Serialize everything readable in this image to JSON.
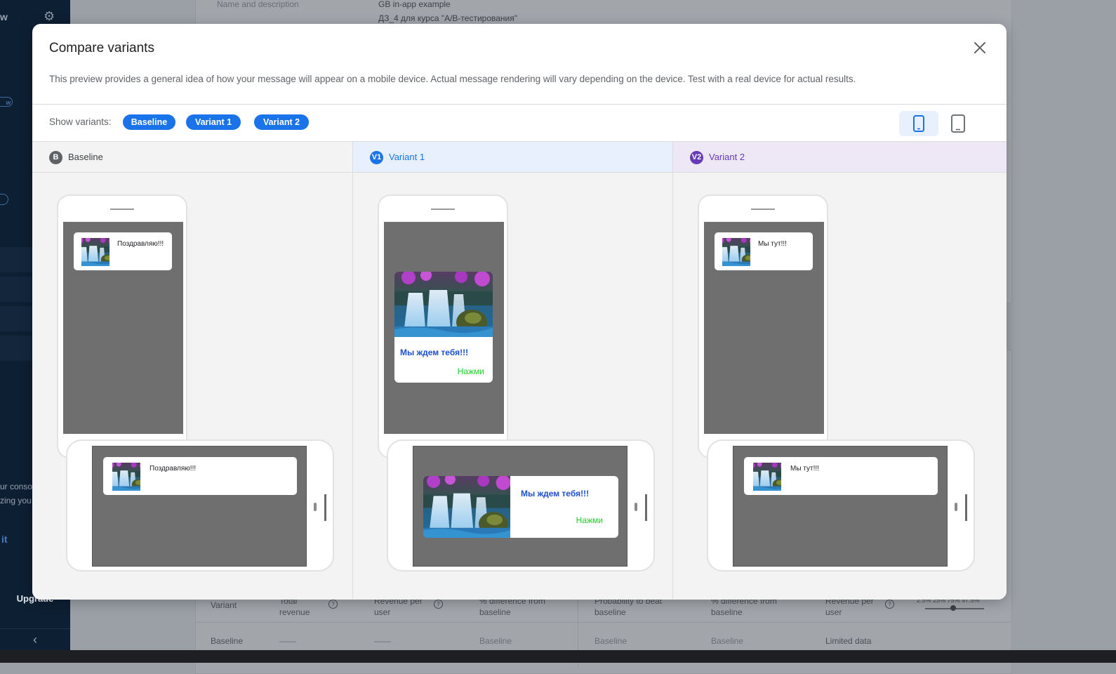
{
  "background": {
    "sidebar": {
      "fragment_top": "w",
      "text_fragment1": "ur conso",
      "text_fragment2": "zing you",
      "link_fragment": "it",
      "upgrade_label": "Upgrade",
      "collapse_glyph": "‹"
    },
    "card": {
      "field_label": "Name and description",
      "name_value": "GB in-app example",
      "description_value": "ДЗ_4 для курса \"A/B-тестирования\""
    },
    "table": {
      "headers": {
        "variant": "Variant",
        "total_revenue": "Total revenue",
        "revenue_per_user": "Revenue per user",
        "pct_diff_1": "% difference from baseline",
        "prob_beat": "Probability to beat baseline",
        "pct_diff_2": "% difference from baseline",
        "revenue_per_user_2": "Revenue per user",
        "interval_labels": "2.5%  25%  75% 97.5%"
      },
      "row": {
        "variant": "Baseline",
        "total_revenue": "——",
        "revenue_per_user": "——",
        "pct_diff_1": "Baseline",
        "prob_beat": "Baseline",
        "pct_diff_2": "Baseline",
        "revenue_per_user_2": "Limited data"
      }
    }
  },
  "modal": {
    "title": "Compare variants",
    "description": "This preview provides a general idea of how your message will appear on a mobile device. Actual message rendering will vary depending on the device. Test with a real device for actual results.",
    "show_variants_label": "Show variants:",
    "chips": [
      "Baseline",
      "Variant 1",
      "Variant 2"
    ],
    "device_toggle": {
      "selected": "phone",
      "options": [
        "phone-icon",
        "tablet-icon"
      ]
    },
    "columns": [
      {
        "badge": "B",
        "title": "Baseline",
        "badge_color": "#5f6368",
        "title_color": "#3c4043",
        "header_bg": "#f3f3f3",
        "format": "banner",
        "message_text": "Поздравляю!!!"
      },
      {
        "badge": "V1",
        "title": "Variant 1",
        "badge_color": "#1a73e8",
        "title_color": "#1a73e8",
        "header_bg": "#e8f0fe",
        "format": "card",
        "message_title": "Мы ждем тебя!!!",
        "action_text": "Нажми"
      },
      {
        "badge": "V2",
        "title": "Variant 2",
        "badge_color": "#673ab7",
        "title_color": "#673ab7",
        "header_bg": "#ede7f6",
        "format": "banner",
        "message_text": "Мы тут!!!"
      }
    ]
  },
  "colors": {
    "accent": "#1a73e8",
    "action_green": "#1ecf2a",
    "message_title_blue": "#1a4fd1"
  }
}
